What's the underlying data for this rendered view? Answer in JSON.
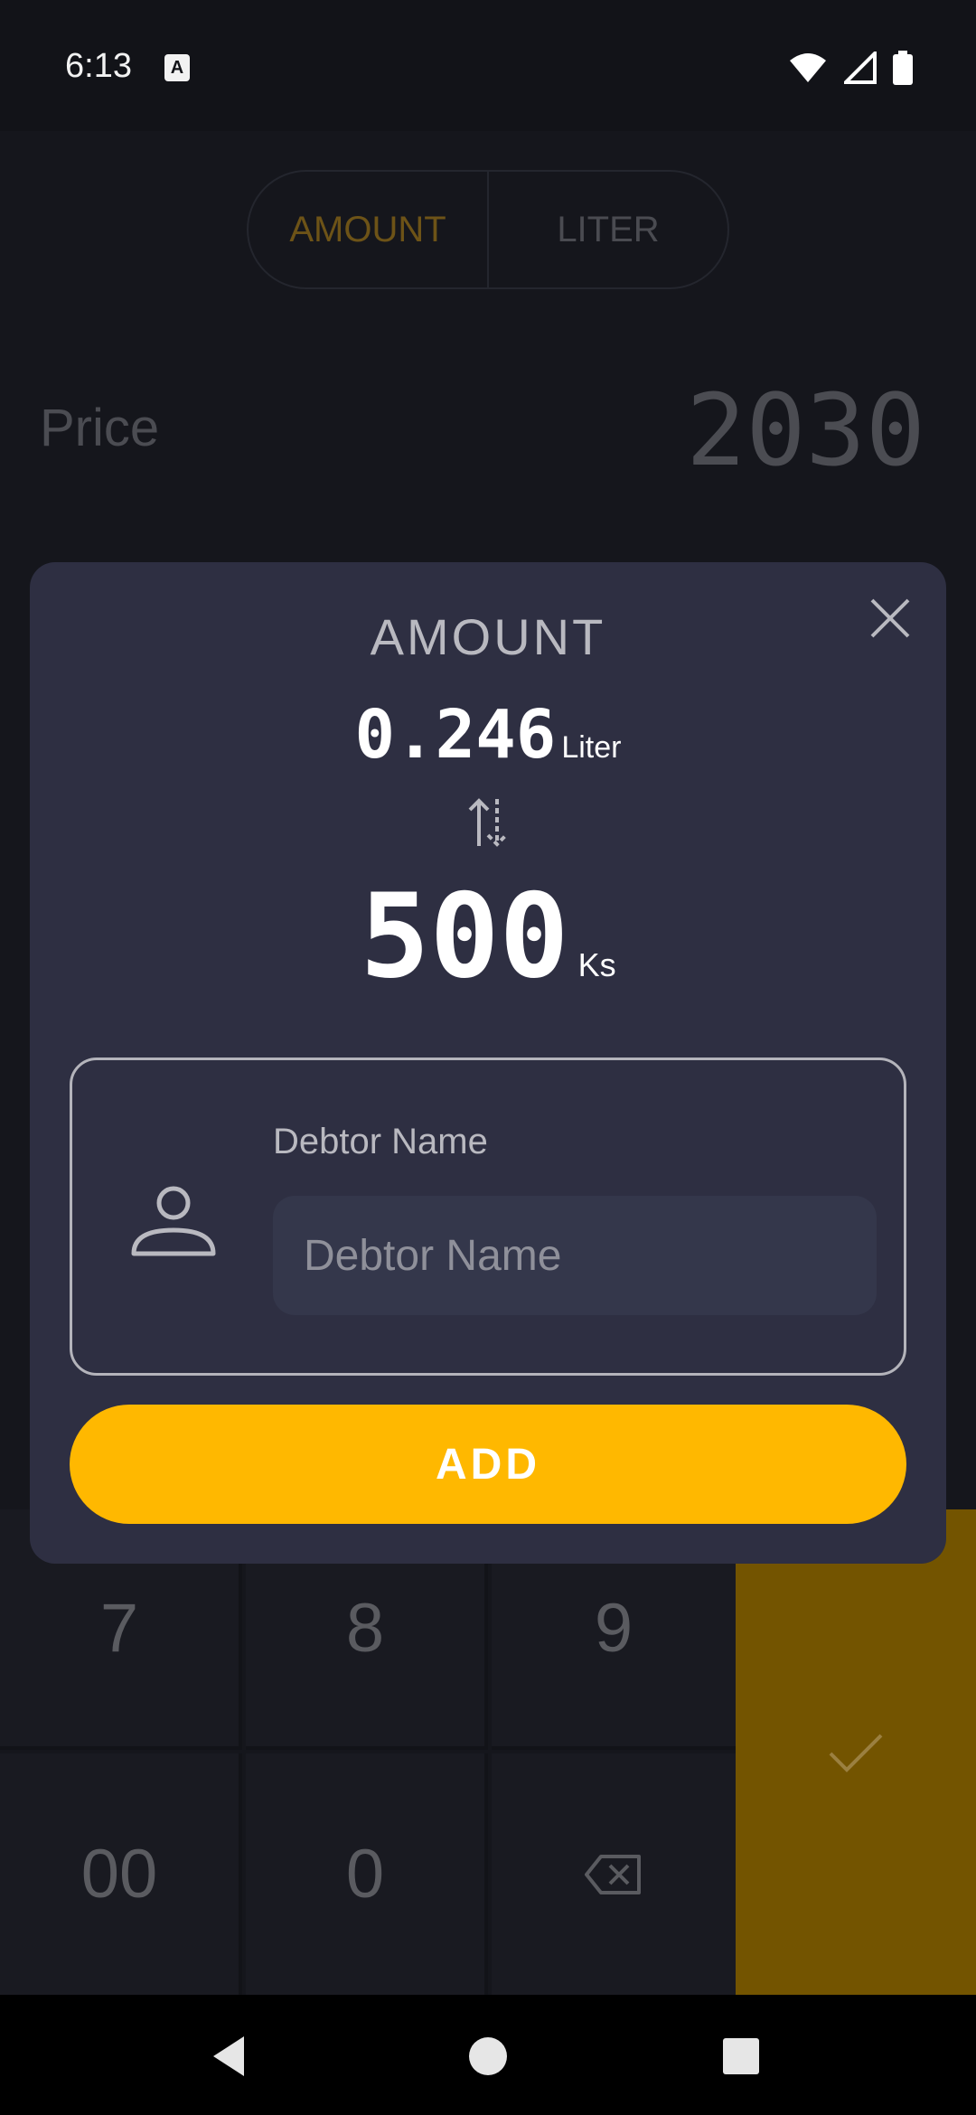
{
  "status_bar": {
    "time": "6:13",
    "app_icon_letter": "A",
    "icons": [
      "wifi-icon",
      "signal-icon",
      "battery-icon"
    ]
  },
  "mode_toggle": {
    "options": [
      "AMOUNT",
      "LITER"
    ],
    "selected": "AMOUNT"
  },
  "price": {
    "label": "Price",
    "value": "2030"
  },
  "keypad": {
    "keys": [
      "7",
      "8",
      "9",
      "00",
      "0"
    ],
    "icons": [
      "backspace-icon",
      "check-icon"
    ]
  },
  "dialog": {
    "title": "AMOUNT",
    "liter_value": "0.246",
    "liter_unit": "Liter",
    "amount_value": "500",
    "amount_unit": "Ks",
    "debtor_label": "Debtor Name",
    "debtor_placeholder": "Debtor Name",
    "add_label": "ADD"
  },
  "colors": {
    "accent": "#ffb800",
    "dialog_bg": "#2e2f42",
    "confirm_key_dim": "#735400"
  }
}
